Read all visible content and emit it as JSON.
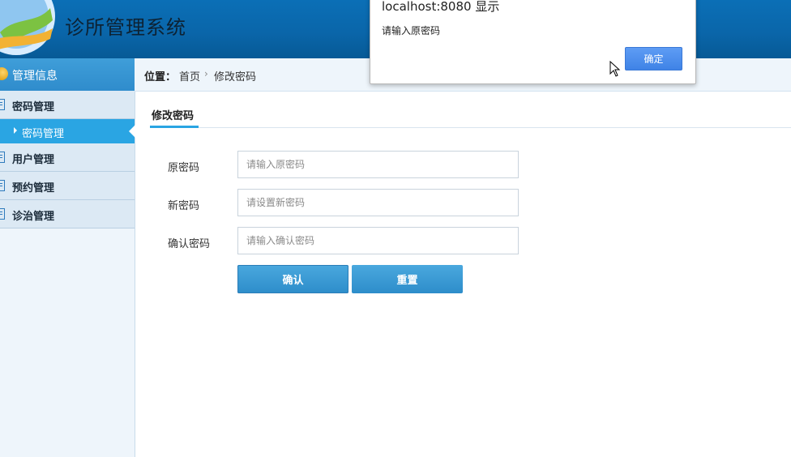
{
  "app": {
    "title": "诊所管理系统"
  },
  "colors": {
    "header": "#0a66aa",
    "accent": "#2aa5e3",
    "button": "#3597d3",
    "dialog_button": "#4a8ff0"
  },
  "sidebar": {
    "header_label": "管理信息",
    "menus": [
      {
        "label": "密码管理",
        "expanded": true
      },
      {
        "label": "用户管理"
      },
      {
        "label": "预约管理"
      },
      {
        "label": "诊治管理"
      }
    ],
    "active_submenu": "密码管理"
  },
  "breadcrumb": {
    "prefix": "位置：",
    "home": "首页",
    "separator": "›",
    "current": "修改密码"
  },
  "main": {
    "tab_label": "修改密码",
    "form": {
      "fields": [
        {
          "label": "原密码",
          "placeholder": "请输入原密码",
          "value": ""
        },
        {
          "label": "新密码",
          "placeholder": "请设置新密码",
          "value": ""
        },
        {
          "label": "确认密码",
          "placeholder": "请输入确认密码",
          "value": ""
        }
      ],
      "confirm_label": "确认",
      "reset_label": "重置"
    }
  },
  "dialog": {
    "title": "localhost:8080 显示",
    "message": "请输入原密码",
    "ok_label": "确定"
  }
}
